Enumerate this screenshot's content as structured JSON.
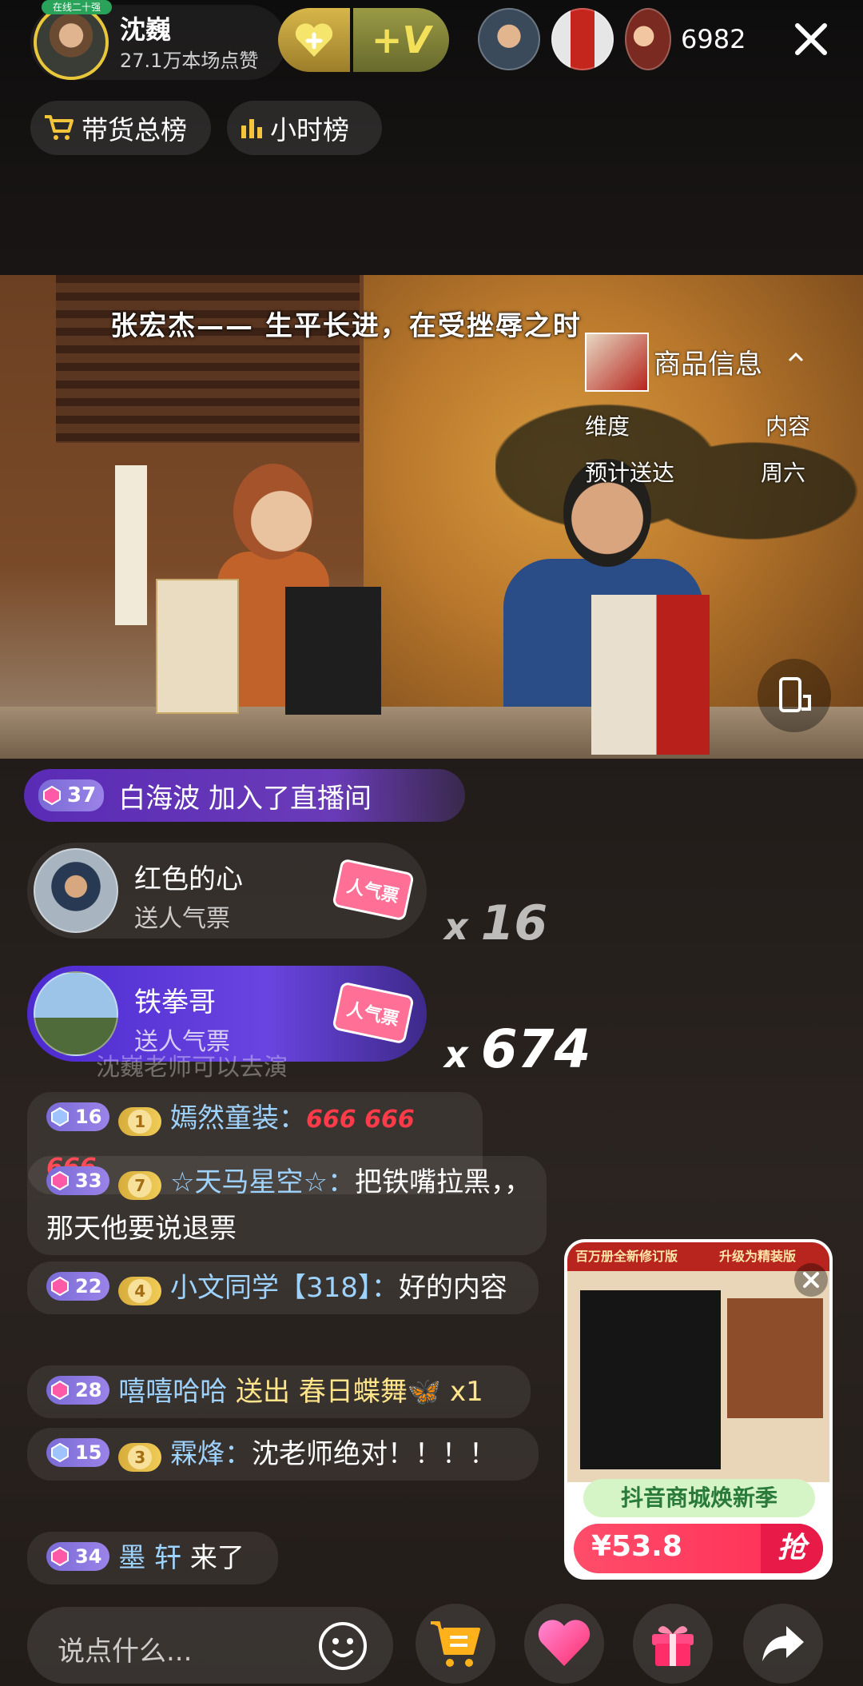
{
  "host": {
    "name": "沈巍",
    "likes": "27.1万本场点赞",
    "badge": "在线二十强"
  },
  "viewers": {
    "count": "6982"
  },
  "rank_tabs": [
    {
      "label": "带货总榜"
    },
    {
      "label": "小时榜"
    }
  ],
  "video": {
    "subtitle": "张宏杰——  生平长进，在受挫辱之时"
  },
  "product_info": {
    "label": "商品信息",
    "k1": "维度",
    "v1": "内容",
    "k2": "预计送达",
    "v2": "周六"
  },
  "join": {
    "level": "37",
    "text": "白海波 加入了直播间"
  },
  "gifts": [
    {
      "name": "红色的心",
      "action": "送人气票",
      "ticket": "人气票",
      "count": "16"
    },
    {
      "name": "铁拳哥",
      "action": "送人气票",
      "ticket": "人气票",
      "count": "674"
    }
  ],
  "chat": [
    {
      "level": "16",
      "fan": "1",
      "user": "嫣然童装：",
      "text": "666 666 666"
    },
    {
      "level": "33",
      "fan": "7",
      "user": "☆天马星空☆：",
      "text": "把铁嘴拉黑，，那天他要说退票"
    },
    {
      "level": "22",
      "fan": "4",
      "user": "小文同学【318】：",
      "text": "好的内容"
    },
    {
      "level": "28",
      "user": "嘻嘻哈哈",
      "text": "送出 春日蝶舞🦋 x1"
    },
    {
      "level": "15",
      "fan": "3",
      "user": "霖烽：",
      "text": "沈老师绝对！！！！"
    },
    {
      "level": "34",
      "user": "墨 轩",
      "text": "来了"
    }
  ],
  "chat_partial": "沈巍老师可以去演",
  "input": {
    "placeholder": "说点什么..."
  },
  "product_card": {
    "header": "百万册全新修订版",
    "subheader": "升级为精装版",
    "promo": "抖音商城焕新季",
    "price": "¥53.8",
    "buy": "抢"
  }
}
